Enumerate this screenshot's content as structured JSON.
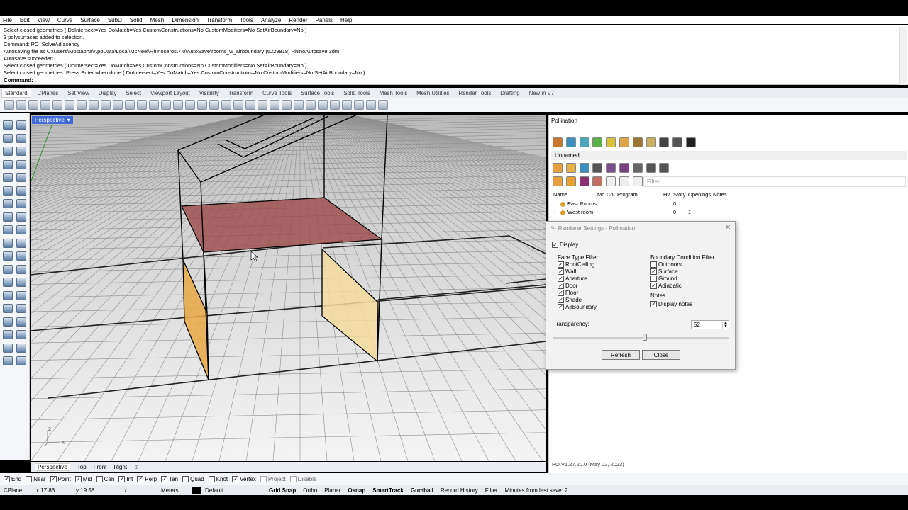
{
  "menu": [
    "File",
    "Edit",
    "View",
    "Curve",
    "Surface",
    "SubD",
    "Solid",
    "Mesh",
    "Dimension",
    "Transform",
    "Tools",
    "Analyze",
    "Render",
    "Panels",
    "Help"
  ],
  "command_history": [
    "Select closed geometries ( DoIntersect=Yes  DoMatch=Yes  CustomConstructions=No  CustomModifiers=No  SetAirBoundary=No )",
    "3 polysurfaces added to selection.",
    "Command: PO_SolveAdjacency",
    "Autosaving file as C:\\Users\\Mostapha\\AppData\\Local\\McNeel\\Rhinoceros\\7.0\\AutoSave\\rooms_w_airboundary (6229818) RhinoAutosave.3dm",
    "Autosave succeeded",
    "Select closed geometries ( DoIntersect=Yes  DoMatch=Yes  CustomConstructions=No  CustomModifiers=No  SetAirBoundary=No )",
    "Select closed geometries. Press Enter when done ( DoIntersect=Yes  DoMatch=Yes  CustomConstructions=No  CustomModifiers=No  SetAirBoundary=No )"
  ],
  "command_prompt": "Command:",
  "toolbar_tabs": [
    "Standard",
    "CPlanes",
    "Set View",
    "Display",
    "Select",
    "Viewport Layout",
    "Visibility",
    "Transform",
    "Curve Tools",
    "Surface Tools",
    "Solid Tools",
    "Mesh Tools",
    "Mesh Utilities",
    "Render Tools",
    "Drafting",
    "New in V7"
  ],
  "viewport": {
    "label": "Perspective",
    "tabs": [
      "Perspective",
      "Top",
      "Front",
      "Right"
    ],
    "axis_labels": {
      "z": "z",
      "x": "x"
    }
  },
  "osnaps": [
    {
      "label": "End",
      "checked": true
    },
    {
      "label": "Near",
      "checked": false
    },
    {
      "label": "Point",
      "checked": true
    },
    {
      "label": "Mid",
      "checked": true
    },
    {
      "label": "Cen",
      "checked": false
    },
    {
      "label": "Int",
      "checked": true
    },
    {
      "label": "Perp",
      "checked": true
    },
    {
      "label": "Tan",
      "checked": true
    },
    {
      "label": "Quad",
      "checked": false
    },
    {
      "label": "Knot",
      "checked": false
    },
    {
      "label": "Vertex",
      "checked": true
    },
    {
      "label": "Project",
      "checked": false
    },
    {
      "label": "Disable",
      "checked": false
    }
  ],
  "status": {
    "cplane": "CPlane",
    "x": "x 17.86",
    "y": "y 19.58",
    "z": "z",
    "units": "Meters",
    "layer": "Default",
    "grid_snap": "Grid Snap",
    "ortho": "Ortho",
    "planar": "Planar",
    "osnap": "Osnap",
    "smarttrack": "SmartTrack",
    "gumball": "Gumball",
    "record_history": "Record History",
    "filter": "Filter",
    "last_save": "Minutes from last save: 2"
  },
  "panel": {
    "title": "Pollination",
    "model_name": "Unnamed",
    "filter_placeholder": "Filter",
    "columns": [
      "Name",
      "Mc",
      "Co",
      "Program",
      "Hv",
      "Story",
      "Openings",
      "Notes"
    ],
    "rows": [
      {
        "name": "East Rooms",
        "story": "0",
        "openings": ""
      },
      {
        "name": "West room",
        "story": "0",
        "openings": "1"
      }
    ],
    "version": "PO.V1.27.20.0 (May 02, 2023)"
  },
  "dialog": {
    "title": "Renderer Settings - Pollination",
    "display_label": "Display",
    "display_checked": true,
    "face_filter_title": "Face Type Filter",
    "face_filters": [
      {
        "label": "RoofCeiling",
        "checked": true
      },
      {
        "label": "Wall",
        "checked": true
      },
      {
        "label": "Aperture",
        "checked": true
      },
      {
        "label": "Door",
        "checked": true
      },
      {
        "label": "Floor",
        "checked": true
      },
      {
        "label": "Shade",
        "checked": true
      },
      {
        "label": "AirBoundary",
        "checked": true
      }
    ],
    "bc_filter_title": "Boundary Condition Filter",
    "bc_filters": [
      {
        "label": "Outdoors",
        "checked": false
      },
      {
        "label": "Surface",
        "checked": true
      },
      {
        "label": "Ground",
        "checked": false
      },
      {
        "label": "Adiabatic",
        "checked": true
      }
    ],
    "notes_title": "Notes",
    "display_notes_label": "Display notes",
    "display_notes_checked": true,
    "transparency_label": "Transparency:",
    "transparency_value": "52",
    "transparency_fraction": 0.52,
    "refresh_label": "Refresh",
    "close_label": "Close"
  },
  "colors": {
    "viewport_label_bg": "#3f6ad8",
    "floor": "#9b4a48",
    "wall_airboundary": "#f4dc9f",
    "wall_orange": "#e9a844"
  }
}
